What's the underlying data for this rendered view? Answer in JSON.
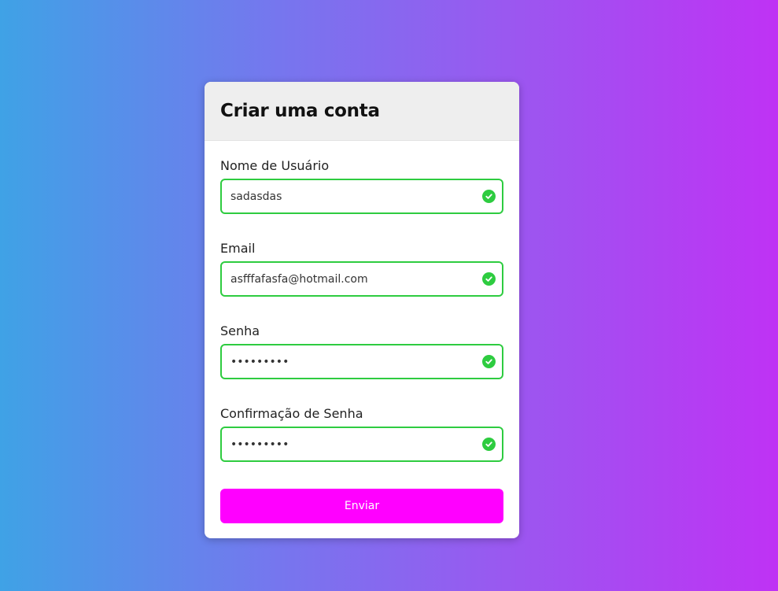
{
  "form": {
    "title": "Criar uma conta",
    "fields": [
      {
        "label": "Nome de Usuário",
        "value": "sadasdas",
        "type": "text",
        "status": "valid"
      },
      {
        "label": "Email",
        "value": "asfffafasfa@hotmail.com",
        "type": "text",
        "status": "valid"
      },
      {
        "label": "Senha",
        "value": "•••••••••",
        "type": "password",
        "status": "valid"
      },
      {
        "label": "Confirmação de Senha",
        "value": "•••••••••",
        "type": "password",
        "status": "valid"
      }
    ],
    "submit_label": "Enviar"
  },
  "colors": {
    "valid": "#2ecc40",
    "submit": "#ff00ff",
    "gradient_start": "#3fa2e6",
    "gradient_end": "#bf32f4"
  },
  "icons": {
    "valid": "check-circle-icon"
  }
}
